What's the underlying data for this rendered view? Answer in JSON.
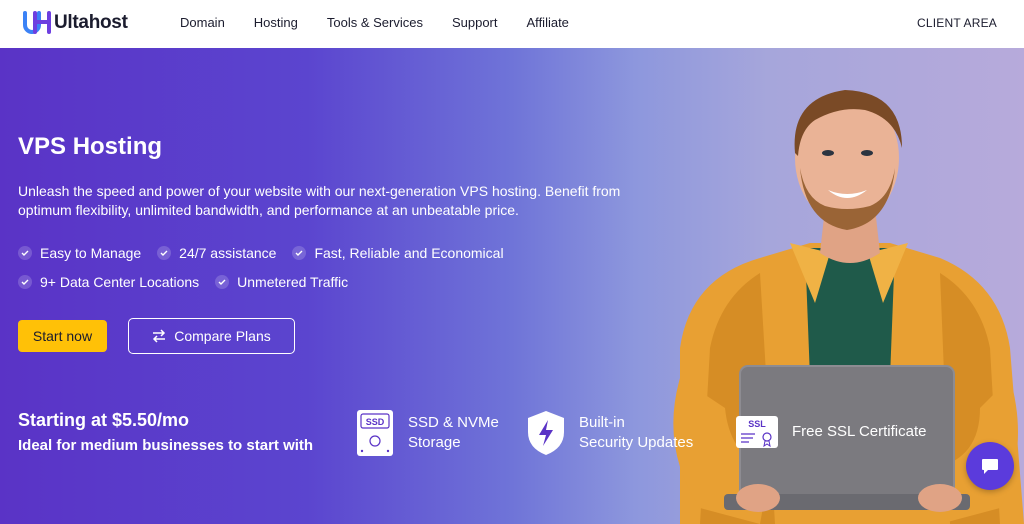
{
  "header": {
    "brand": "Ultahost",
    "nav": [
      "Domain",
      "Hosting",
      "Tools & Services",
      "Support",
      "Affiliate"
    ],
    "client_area": "CLIENT AREA"
  },
  "hero": {
    "title": "VPS Hosting",
    "description": "Unleash the speed and power of your website with our next-generation VPS hosting. Benefit from optimum flexibility, unlimited bandwidth, and performance at an unbeatable price.",
    "features_row1": [
      "Easy to Manage",
      "24/7 assistance",
      "Fast, Reliable and Economical"
    ],
    "features_row2": [
      "9+ Data Center Locations",
      "Unmetered Traffic"
    ],
    "start_button": "Start now",
    "compare_button": "Compare Plans",
    "price_text": "Starting at $5.50/mo",
    "price_subtitle": "Ideal for medium businesses to start with"
  },
  "badges": [
    {
      "line1": "SSD & NVMe",
      "line2": "Storage",
      "icon": "ssd-icon",
      "icon_label": "SSD"
    },
    {
      "line1": "Built-in",
      "line2": "Security Updates",
      "icon": "shield-bolt-icon"
    },
    {
      "line1": "Free SSL Certificate",
      "line2": "",
      "icon": "ssl-certificate-icon",
      "icon_label": "SSL"
    }
  ],
  "colors": {
    "accent_yellow": "#ffc107",
    "hero_purple": "#5a33c6",
    "chat_purple": "#5b3bdc"
  }
}
